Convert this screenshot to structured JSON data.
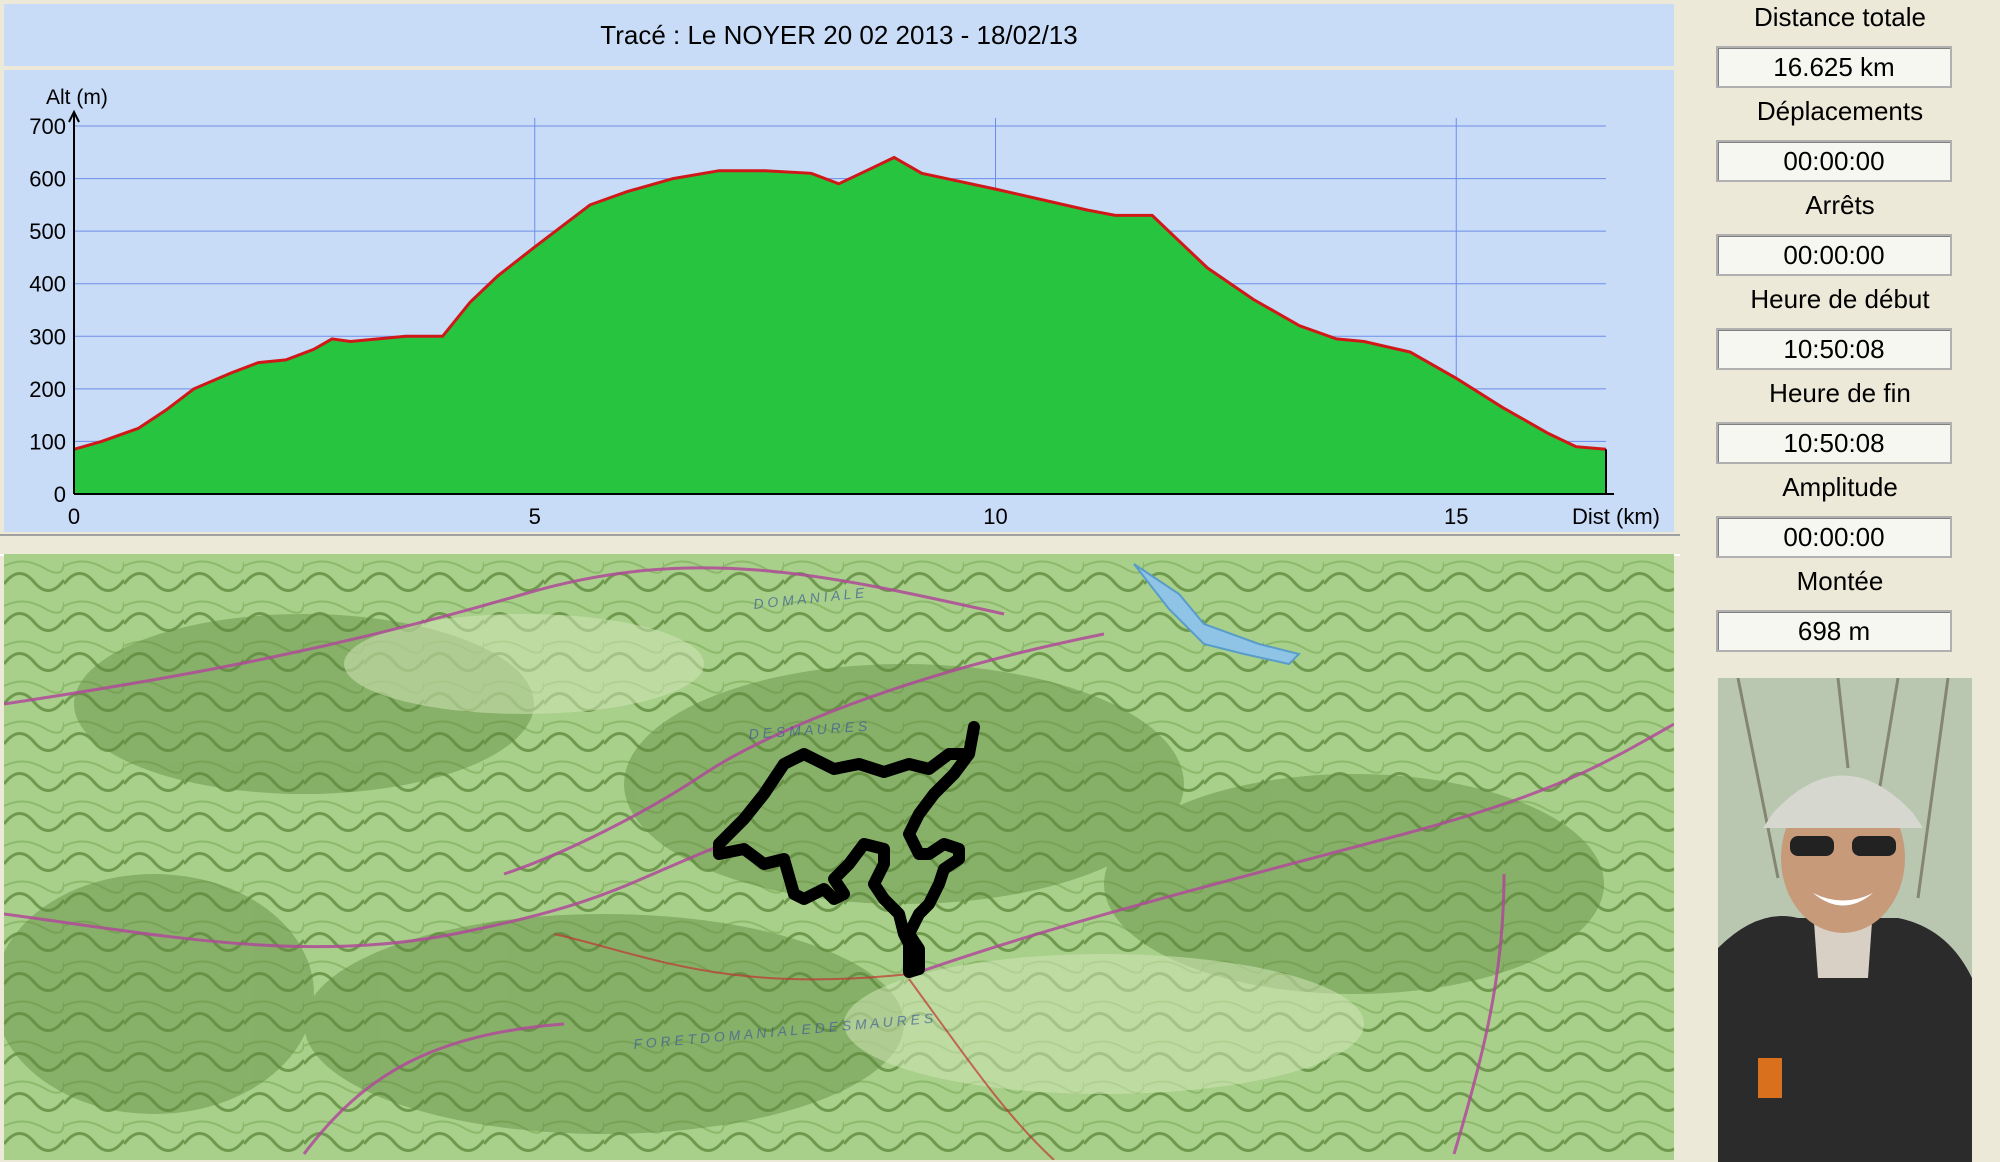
{
  "window": {
    "title": "Tracé : Le NOYER 20 02 2013 - 18/02/13"
  },
  "stats": [
    {
      "label": "Distance totale",
      "value": "16.625 km"
    },
    {
      "label": "Déplacements",
      "value": "00:00:00"
    },
    {
      "label": "Arrêts",
      "value": "00:00:00"
    },
    {
      "label": "Heure de début",
      "value": "10:50:08"
    },
    {
      "label": "Heure de fin",
      "value": "10:50:08"
    },
    {
      "label": "Amplitude",
      "value": "00:00:00"
    },
    {
      "label": "Montée",
      "value": "698 m"
    }
  ],
  "colors": {
    "panel_bg": "#c8dcf8",
    "grid": "#6f8de8",
    "fill": "#27c440",
    "line": "#d01818"
  },
  "chart_data": {
    "type": "area",
    "ylabel": "Alt (m)",
    "xlabel": "Dist (km)",
    "xlim": [
      0,
      16.625
    ],
    "ylim": [
      0,
      700
    ],
    "x_ticks": [
      "0",
      "5",
      "10",
      "15"
    ],
    "y_ticks": [
      "0",
      "100",
      "200",
      "300",
      "400",
      "500",
      "600",
      "700"
    ],
    "grid": true,
    "series": [
      {
        "x": [
          0,
          0.3,
          0.7,
          1.0,
          1.3,
          1.7,
          2.0,
          2.3,
          2.6,
          2.8,
          3.0,
          3.3,
          3.6,
          4.0,
          4.3,
          4.6,
          5.0,
          5.3,
          5.6,
          6.0,
          6.5,
          7.0,
          7.5,
          8.0,
          8.3,
          8.6,
          8.9,
          9.2,
          9.6,
          10.0,
          10.5,
          11.0,
          11.3,
          11.7,
          12.0,
          12.3,
          12.8,
          13.3,
          13.7,
          14.0,
          14.5,
          15.0,
          15.5,
          16.0,
          16.3,
          16.625
        ],
        "values": [
          85,
          100,
          125,
          160,
          200,
          230,
          250,
          255,
          275,
          295,
          290,
          295,
          300,
          300,
          365,
          415,
          470,
          510,
          550,
          575,
          600,
          615,
          615,
          610,
          590,
          615,
          640,
          610,
          595,
          580,
          560,
          540,
          530,
          530,
          480,
          430,
          370,
          320,
          295,
          290,
          270,
          220,
          165,
          115,
          90,
          85
        ]
      }
    ]
  }
}
